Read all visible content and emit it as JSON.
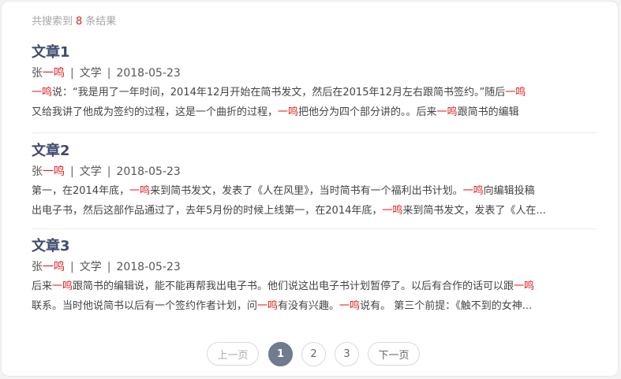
{
  "summary": {
    "prefix": "共搜索到",
    "count": "8",
    "suffix": "条结果"
  },
  "results": [
    {
      "title": "文章1",
      "author_a": "张",
      "author_hl": "一鸣",
      "category": "文学",
      "date": "2018-05-23",
      "line1": [
        {
          "t": "一鸣",
          "hl": true
        },
        {
          "t": "说：“我是用了一年时间，2014年12月开始在简书发文，然后在2015年12月左右跟简书签约。”随后",
          "hl": false
        },
        {
          "t": "一鸣",
          "hl": true
        }
      ],
      "line2": [
        {
          "t": "又给我讲了他成为签约的过程，这是一个曲折的过程，",
          "hl": false
        },
        {
          "t": "一鸣",
          "hl": true
        },
        {
          "t": "把他分为四个部分讲的。。后来",
          "hl": false
        },
        {
          "t": "一鸣",
          "hl": true
        },
        {
          "t": "跟简书的编辑",
          "hl": false
        }
      ]
    },
    {
      "title": "文章2",
      "author_a": "张",
      "author_hl": "一鸣",
      "category": "文学",
      "date": "2018-05-23",
      "line1": [
        {
          "t": "第一，在2014年底，",
          "hl": false
        },
        {
          "t": "一鸣",
          "hl": true
        },
        {
          "t": "来到简书发文，发表了《人在风里》，当时简书有一个福利出书计划。",
          "hl": false
        },
        {
          "t": "一鸣",
          "hl": true
        },
        {
          "t": "向编辑投稿",
          "hl": false
        }
      ],
      "line2": [
        {
          "t": "出电子书，然后这部作品通过了，去年5月份的时候上线第一，在2014年底，",
          "hl": false
        },
        {
          "t": "一鸣",
          "hl": true
        },
        {
          "t": "来到简书发文，发表了《人在...",
          "hl": false
        }
      ]
    },
    {
      "title": "文章3",
      "author_a": "张",
      "author_hl": "一鸣",
      "category": "文学",
      "date": "2018-05-23",
      "line1": [
        {
          "t": "后来",
          "hl": false
        },
        {
          "t": "一鸣",
          "hl": true
        },
        {
          "t": "跟简书的编辑说，能不能再帮我出电子书。他们说这出电子书计划暂停了。以后有合作的话可以跟",
          "hl": false
        },
        {
          "t": "一鸣",
          "hl": true
        }
      ],
      "line2": [
        {
          "t": "联系。当时他说简书以后有一个签约作者计划，问",
          "hl": false
        },
        {
          "t": "一鸣",
          "hl": true
        },
        {
          "t": "有没有兴趣。",
          "hl": false
        },
        {
          "t": "一鸣",
          "hl": true
        },
        {
          "t": "说有。 第三个前提：《触不到的女神...",
          "hl": false
        }
      ]
    }
  ],
  "pagination": {
    "prev_label": "上一页",
    "pages": [
      "1",
      "2",
      "3"
    ],
    "current": "1",
    "next_label": "下一页"
  },
  "colors": {
    "highlight": "#e02020",
    "title": "#3f4a6e",
    "active_page": "#6f7b8f"
  }
}
